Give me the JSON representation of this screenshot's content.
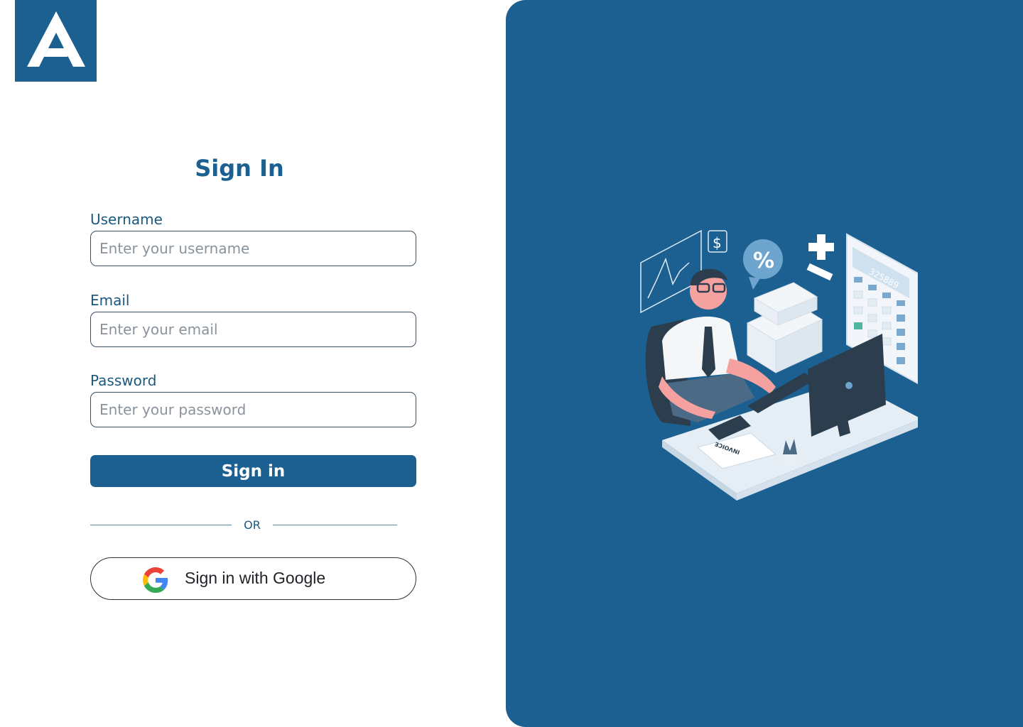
{
  "logo": {
    "icon": "letter-a-logo",
    "color": "#1b6090"
  },
  "form": {
    "title": "Sign In",
    "username": {
      "label": "Username",
      "placeholder": "Enter your username",
      "value": ""
    },
    "email": {
      "label": "Email",
      "placeholder": "Enter your email",
      "value": ""
    },
    "password": {
      "label": "Password",
      "placeholder": "Enter your password",
      "value": ""
    },
    "submit_label": "Sign in",
    "divider_text": "OR",
    "google": {
      "label": "Sign in with Google",
      "icon": "google-g-icon"
    }
  },
  "illustration": {
    "icon": "accountant-at-desk-illustration",
    "calculator_display": "325889",
    "invoice_label": "INVOICE",
    "percent_symbol": "%",
    "dollar_symbol": "$"
  },
  "colors": {
    "brand": "#1b6090",
    "text": "#1b5880",
    "button_text": "#ffffff"
  }
}
